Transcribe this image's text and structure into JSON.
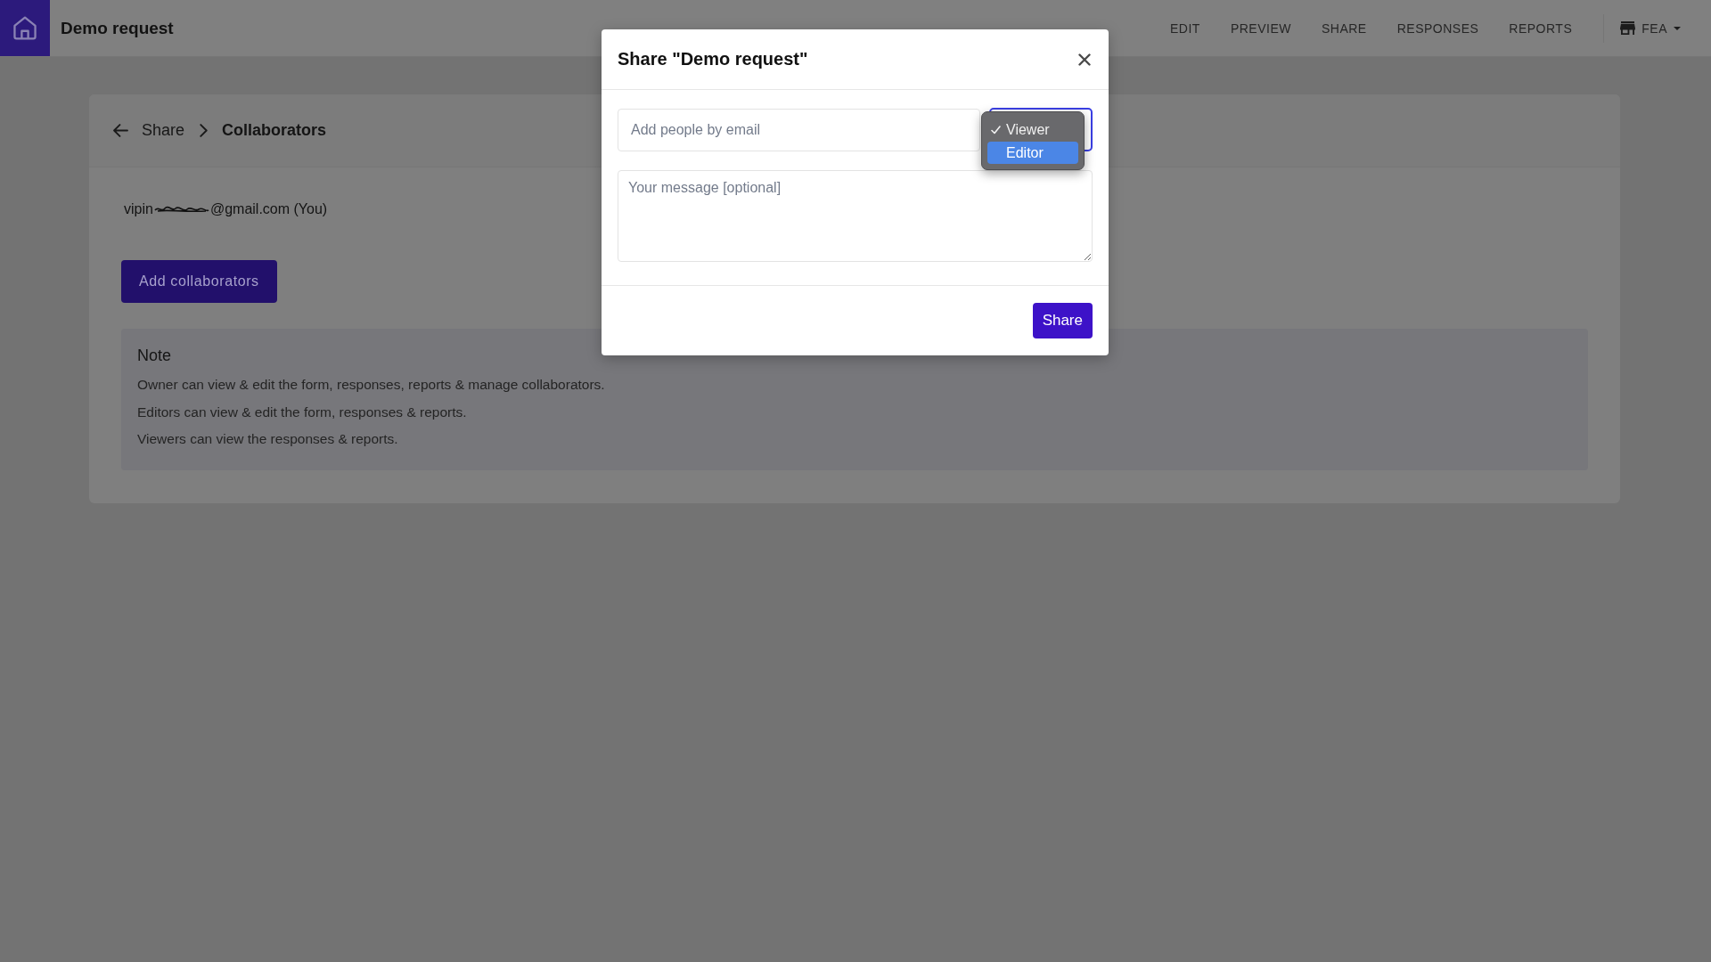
{
  "app_bar": {
    "title": "Demo request",
    "nav": [
      "EDIT",
      "PREVIEW",
      "SHARE",
      "RESPONSES",
      "REPORTS"
    ],
    "workspace": "FEA"
  },
  "page": {
    "breadcrumb": {
      "parent": "Share",
      "current": "Collaborators"
    },
    "collaborators": [
      {
        "email_start": "vipin",
        "email_end": "@gmail.com (You)",
        "redacted": true
      }
    ],
    "add_button": "Add collaborators",
    "note": {
      "title": "Note",
      "lines": [
        "Owner can view & edit the form, responses, reports & manage collaborators.",
        "Editors can view & edit the form, responses & reports.",
        "Viewers can view the responses & reports."
      ]
    }
  },
  "share_dialog": {
    "title": "Share \"Demo request\"",
    "email_field": {
      "placeholder": "Add people by email"
    },
    "role_select": {
      "expanded": true,
      "options": [
        {
          "label": "Viewer",
          "selected": true,
          "highlighted": false
        },
        {
          "label": "Editor",
          "selected": false,
          "highlighted": true
        }
      ]
    },
    "message_field": {
      "placeholder": "Your message [optional]"
    },
    "share_button": "Share"
  }
}
